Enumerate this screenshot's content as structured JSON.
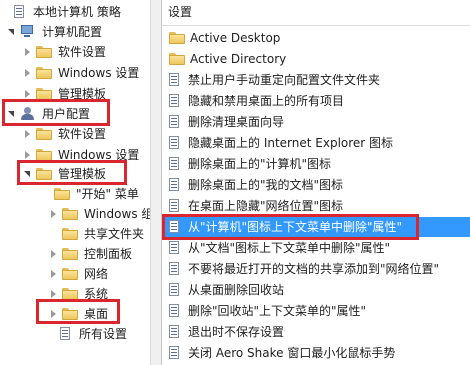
{
  "tree": {
    "root": "本地计算机 策略",
    "computer_config": "计算机配置",
    "computer_software": "软件设置",
    "computer_windows": "Windows 设置",
    "computer_admin": "管理模板",
    "user_config": "用户配置",
    "user_software": "软件设置",
    "user_windows": "Windows 设置",
    "user_admin": "管理模板",
    "start_menu": "\"开始\" 菜单",
    "windows_components": "Windows 组",
    "shared_folders": "共享文件夹",
    "control_panel": "控制面板",
    "network": "网络",
    "system": "系统",
    "desktop": "桌面",
    "all_settings": "所有设置"
  },
  "list": {
    "header": "设置",
    "items": [
      {
        "label": "Active Desktop",
        "icon": "folder-icon"
      },
      {
        "label": "Active Directory",
        "icon": "folder-icon"
      },
      {
        "label": "禁止用户手动重定向配置文件文件夹",
        "icon": "policy-icon"
      },
      {
        "label": "隐藏和禁用桌面上的所有项目",
        "icon": "policy-icon"
      },
      {
        "label": "删除清理桌面向导",
        "icon": "policy-icon"
      },
      {
        "label": "隐藏桌面上的 Internet Explorer 图标",
        "icon": "policy-icon"
      },
      {
        "label": "删除桌面上的\"计算机\"图标",
        "icon": "policy-icon"
      },
      {
        "label": "删除桌面上的\"我的文档\"图标",
        "icon": "policy-icon"
      },
      {
        "label": "在桌面上隐藏\"网络位置\"图标",
        "icon": "policy-icon"
      },
      {
        "label": "从\"计算机\"图标上下文菜单中删除\"属性\"",
        "icon": "policy-icon"
      },
      {
        "label": "从\"文档\"图标上下文菜单中删除\"属性\"",
        "icon": "policy-icon"
      },
      {
        "label": "不要将最近打开的文档的共享添加到\"网络位置\"",
        "icon": "policy-icon"
      },
      {
        "label": "从桌面删除回收站",
        "icon": "policy-icon"
      },
      {
        "label": "删除\"回收站\"上下文菜单的\"属性\"",
        "icon": "policy-icon"
      },
      {
        "label": "退出时不保存设置",
        "icon": "policy-icon"
      },
      {
        "label": "关闭 Aero Shake 窗口最小化鼠标手势",
        "icon": "policy-icon"
      }
    ],
    "selected_index": 9
  },
  "colors": {
    "selection": "#3399ff",
    "highlight_box": "#d9262f",
    "folder": "#f4d27a"
  }
}
